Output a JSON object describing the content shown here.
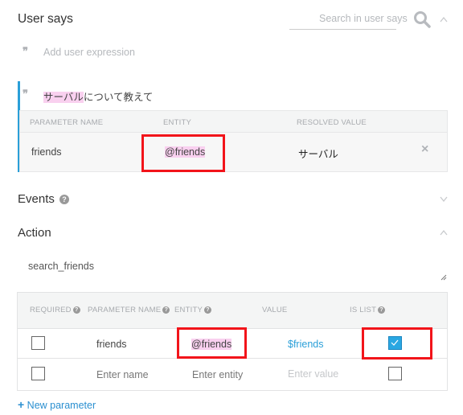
{
  "user_says": {
    "title": "User says",
    "search_placeholder": "Search in user says",
    "add_placeholder": "Add user expression",
    "phrase": {
      "highlighted": "サーバル",
      "rest": "について教えて"
    },
    "table": {
      "headers": [
        "PARAMETER NAME",
        "ENTITY",
        "RESOLVED VALUE"
      ],
      "row": {
        "name": "friends",
        "entity": "@friends",
        "resolved": "サーバル"
      }
    }
  },
  "events": {
    "title": "Events"
  },
  "action": {
    "title": "Action",
    "value": "search_friends",
    "table": {
      "headers": [
        "REQUIRED",
        "PARAMETER NAME",
        "ENTITY",
        "VALUE",
        "IS LIST"
      ],
      "rows": [
        {
          "required": false,
          "name": "friends",
          "entity": "@friends",
          "value": "$friends",
          "is_list": true
        }
      ],
      "new_row": {
        "name_placeholder": "Enter name",
        "entity_placeholder": "Enter entity",
        "value_placeholder": "Enter value"
      }
    },
    "new_parameter": "New parameter"
  },
  "colors": {
    "accent": "#2a9fd8",
    "highlight": "#f9d0ef",
    "annotation": "#f2141a"
  }
}
